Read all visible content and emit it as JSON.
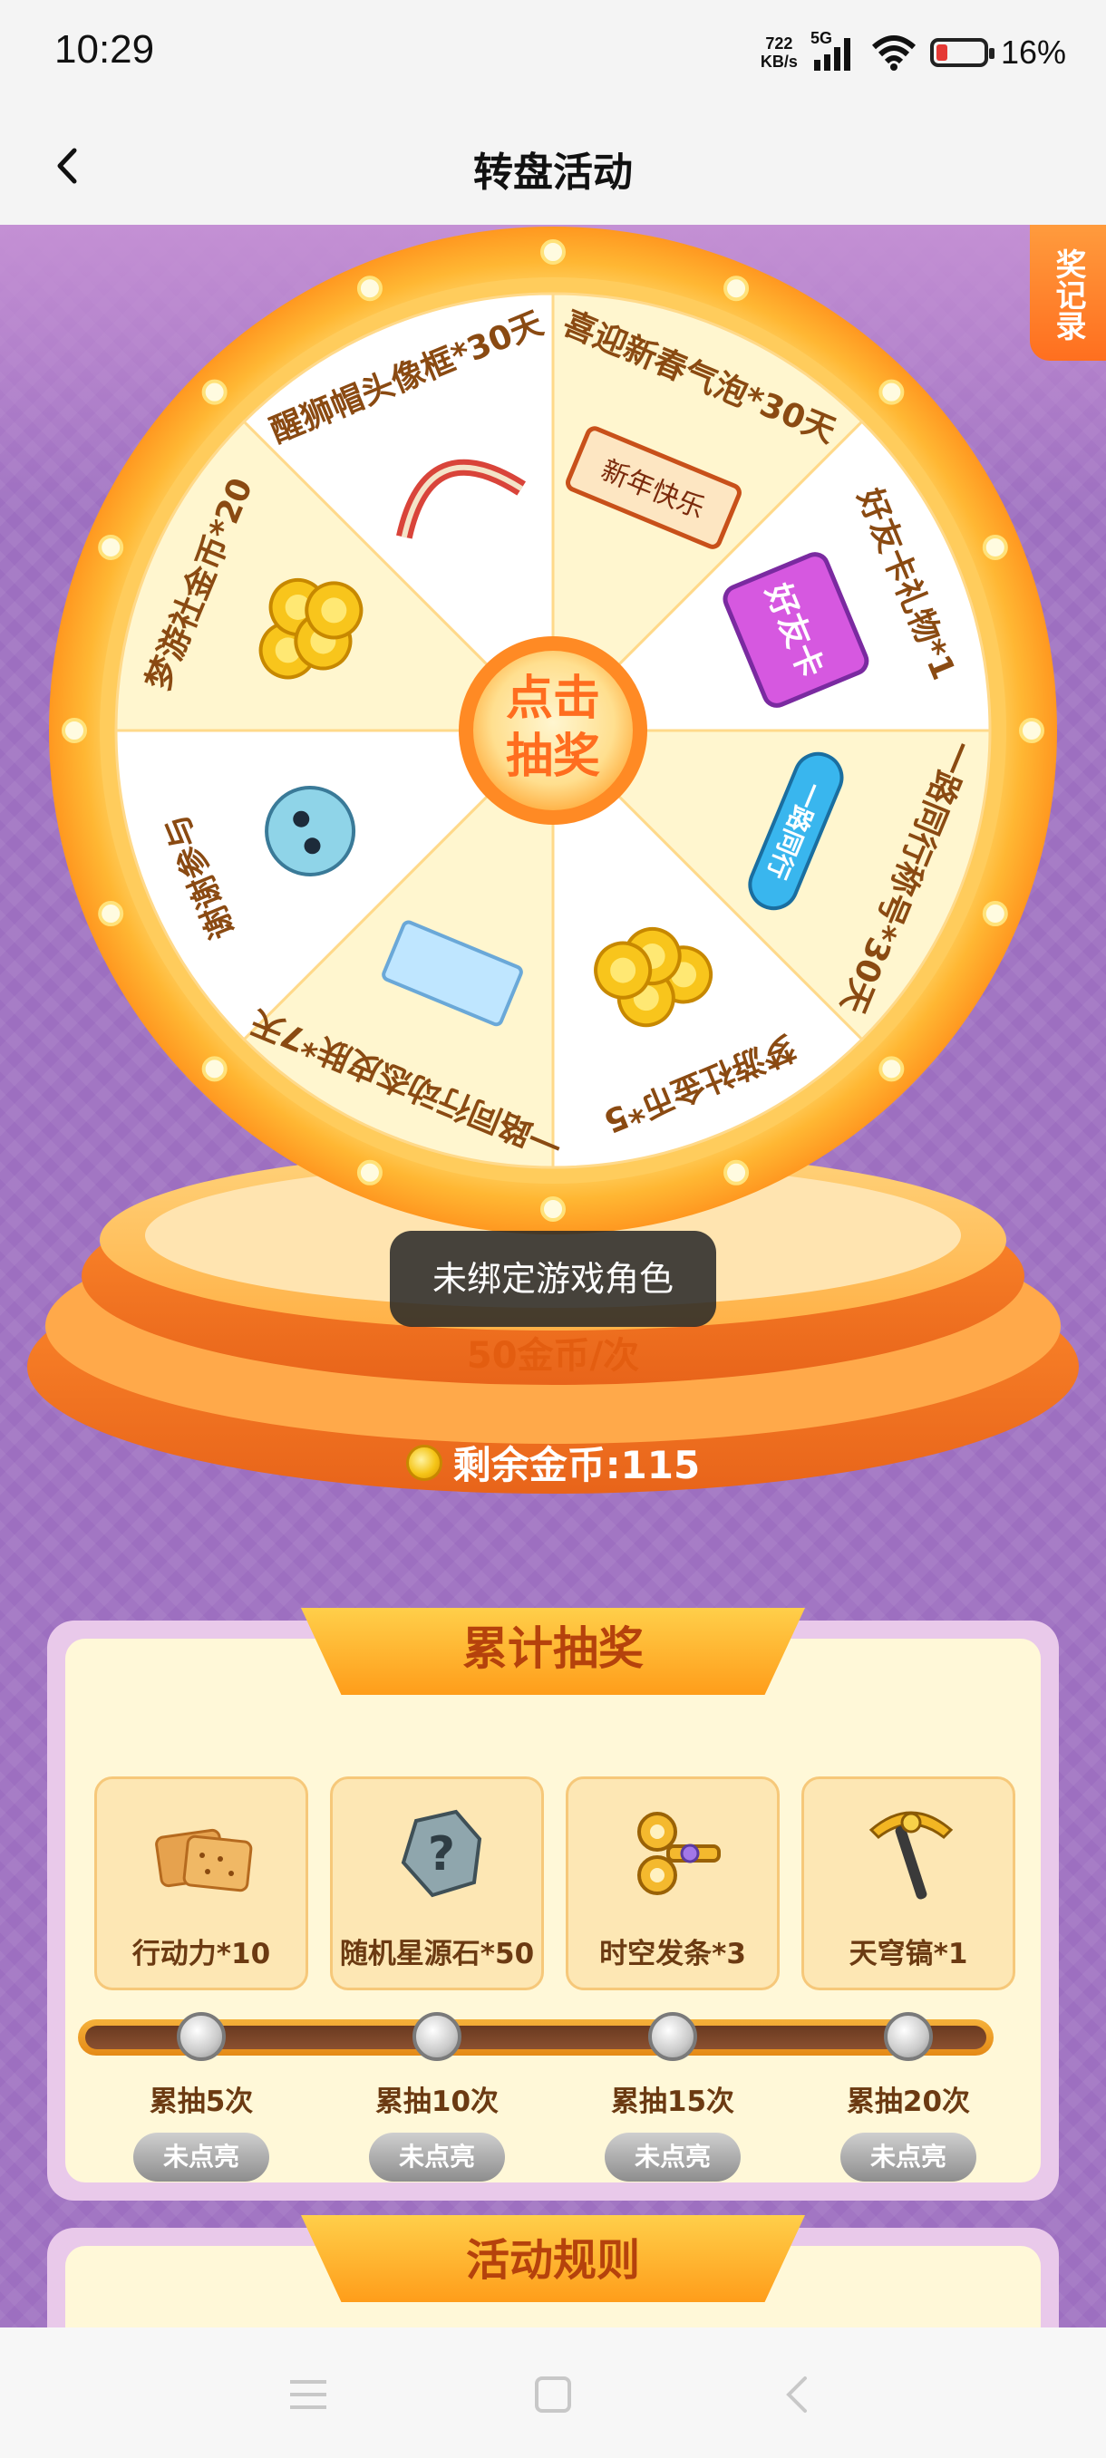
{
  "status_bar": {
    "time": "10:29",
    "net_speed_value": "722",
    "net_speed_unit": "KB/s",
    "network": "5G",
    "battery": "16%"
  },
  "header": {
    "title": "转盘活动"
  },
  "record_tab": {
    "label": "奖记录"
  },
  "wheel": {
    "center_line1": "点击",
    "center_line2": "抽奖",
    "prizes": [
      {
        "label": "喜迎新春气泡*30天",
        "icon": "new-year-scroll-icon",
        "icon_text": "新年快乐"
      },
      {
        "label": "好友卡礼物*1",
        "icon": "friend-card-icon",
        "icon_text": "好友卡"
      },
      {
        "label": "一路同行称号*30天",
        "icon": "title-badge-icon",
        "icon_text": "一路同行"
      },
      {
        "label": "梦游社金币*5",
        "icon": "coins-icon"
      },
      {
        "label": "一路同行动态皮肤*7天",
        "icon": "skin-card-icon"
      },
      {
        "label": "谢谢参与",
        "icon": "dragon-mascot-icon"
      },
      {
        "label": "梦游社金币*20",
        "icon": "coins-icon"
      },
      {
        "label": "醒狮帽头像框*30天",
        "icon": "lion-headband-icon"
      }
    ]
  },
  "toast": {
    "text": "未绑定游戏角色"
  },
  "cost": {
    "label": "50金币/次"
  },
  "coins": {
    "label": "剩余金币:115"
  },
  "cumulative": {
    "title": "累计抽奖",
    "rewards": [
      {
        "label": "行动力*10",
        "icon": "biscuit-icon"
      },
      {
        "label": "随机星源石*50",
        "icon": "mystery-stone-icon"
      },
      {
        "label": "时空发条*3",
        "icon": "wind-up-key-icon"
      },
      {
        "label": "天穹镐*1",
        "icon": "pickaxe-icon"
      }
    ],
    "milestones": [
      {
        "label": "累抽5次",
        "status": "未点亮"
      },
      {
        "label": "累抽10次",
        "status": "未点亮"
      },
      {
        "label": "累抽15次",
        "status": "未点亮"
      },
      {
        "label": "累抽20次",
        "status": "未点亮"
      }
    ],
    "progress": 0
  },
  "rules": {
    "title": "活动规则"
  },
  "colors": {
    "background_purple": "#9d6fc0",
    "wheel_gold": "#ffb733",
    "accent_orange": "#ff7a1f"
  }
}
